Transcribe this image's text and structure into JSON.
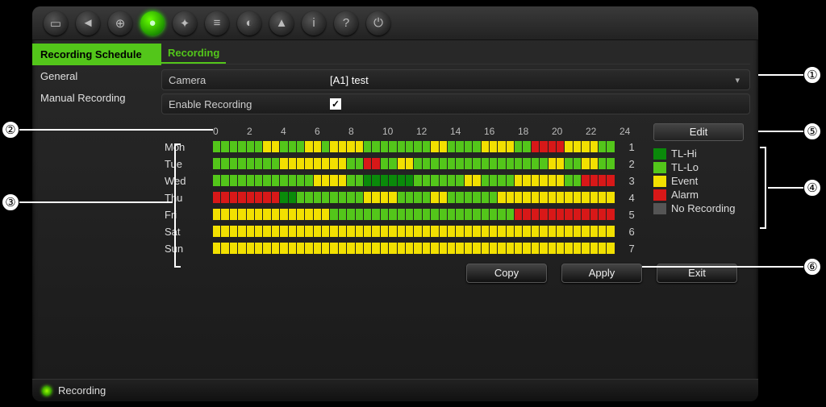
{
  "toolbar": {
    "icons": [
      {
        "name": "monitor-icon",
        "glyph": "▭"
      },
      {
        "name": "camera-icon",
        "glyph": "◄"
      },
      {
        "name": "network-icon",
        "glyph": "⊕"
      },
      {
        "name": "record-icon",
        "glyph": "●",
        "active": true
      },
      {
        "name": "motion-icon",
        "glyph": "✦"
      },
      {
        "name": "playback-icon",
        "glyph": "≡"
      },
      {
        "name": "hdd-icon",
        "glyph": "◐"
      },
      {
        "name": "user-icon",
        "glyph": "▲"
      },
      {
        "name": "info-icon",
        "glyph": "i"
      },
      {
        "name": "help-icon",
        "glyph": "?"
      },
      {
        "name": "power-icon",
        "glyph": "⏻"
      }
    ]
  },
  "sidebar": {
    "items": [
      {
        "label": "Recording Schedule",
        "active": true
      },
      {
        "label": "General",
        "active": false
      },
      {
        "label": "Manual Recording",
        "active": false
      }
    ]
  },
  "tab": {
    "label": "Recording"
  },
  "form": {
    "camera_label": "Camera",
    "camera_value": "[A1] test",
    "enable_label": "Enable Recording",
    "enable_checked": true
  },
  "schedule": {
    "hours": [
      "0",
      "2",
      "4",
      "6",
      "8",
      "10",
      "12",
      "14",
      "16",
      "18",
      "20",
      "22",
      "24"
    ],
    "days": [
      "Mon",
      "Tue",
      "Wed",
      "Thu",
      "Fri",
      "Sat",
      "Sun"
    ],
    "row_numbers": [
      "1",
      "2",
      "3",
      "4",
      "5",
      "6",
      "7"
    ],
    "colors": {
      "hi": "#0a8a0a",
      "lo": "#53c61a",
      "ev": "#f2e000",
      "al": "#d81818",
      "no": "#555555"
    },
    "legend": [
      {
        "key": "hi",
        "label": "TL-Hi"
      },
      {
        "key": "lo",
        "label": "TL-Lo"
      },
      {
        "key": "ev",
        "label": "Event"
      },
      {
        "key": "al",
        "label": "Alarm"
      },
      {
        "key": "no",
        "label": "No Recording"
      }
    ],
    "edit_btn": "Edit",
    "grid": [
      "lo lo lo lo lo lo ev ev lo lo lo ev ev lo ev ev ev ev lo lo lo lo lo lo lo lo ev ev lo lo lo lo ev ev ev ev lo lo al al al al ev ev ev ev lo lo",
      "lo lo lo lo lo lo lo lo ev ev ev ev ev ev ev ev lo lo al al lo lo ev ev lo lo lo lo lo lo lo lo lo lo lo lo lo lo lo lo ev ev lo lo ev ev lo lo",
      "lo lo lo lo lo lo lo lo lo lo lo lo ev ev ev ev lo lo hi hi hi hi hi hi lo lo lo lo lo lo ev ev lo lo lo lo ev ev ev ev ev ev lo lo al al al al",
      "al al al al al al al al hi hi lo lo lo lo lo lo lo lo ev ev ev ev lo lo lo lo ev ev lo lo lo lo lo lo ev ev ev ev ev ev ev ev ev ev ev ev ev ev",
      "ev ev ev ev ev ev ev ev ev ev ev ev ev ev lo lo lo lo lo lo lo lo lo lo lo lo lo lo lo lo lo lo lo lo lo lo al al al al al al al al al al al al",
      "ev ev ev ev ev ev ev ev ev ev ev ev ev ev ev ev ev ev ev ev ev ev ev ev ev ev ev ev ev ev ev ev ev ev ev ev ev ev ev ev ev ev ev ev ev ev ev ev",
      "ev ev ev ev ev ev ev ev ev ev ev ev ev ev ev ev ev ev ev ev ev ev ev ev ev ev ev ev ev ev ev ev ev ev ev ev ev ev ev ev ev ev ev ev ev ev ev ev"
    ]
  },
  "buttons": {
    "copy": "Copy",
    "apply": "Apply",
    "exit": "Exit"
  },
  "status": {
    "label": "Recording"
  },
  "callouts": {
    "1": "①",
    "2": "②",
    "3": "③",
    "4": "④",
    "5": "⑤",
    "6": "⑥"
  }
}
